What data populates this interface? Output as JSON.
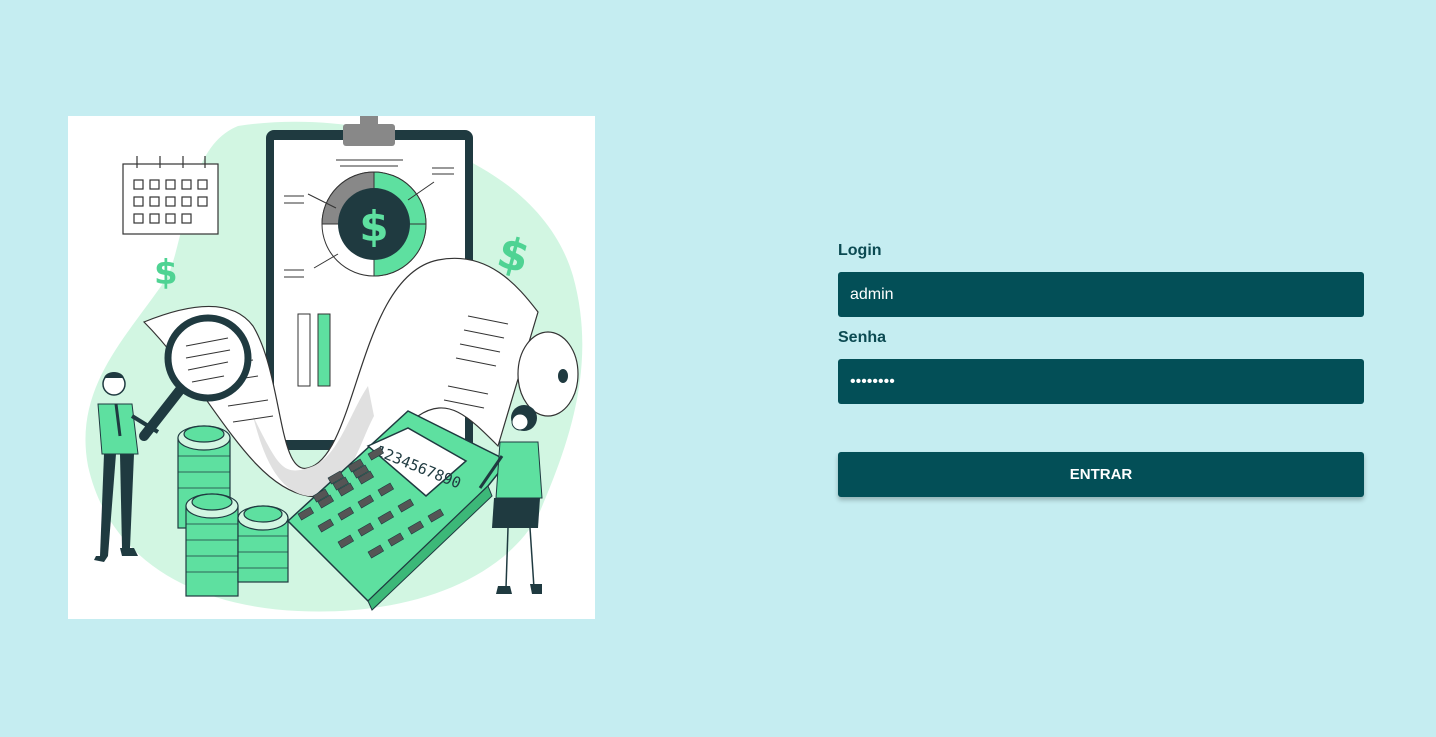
{
  "login_form": {
    "login_label": "Login",
    "login_value": "admin",
    "password_label": "Senha",
    "password_value": "password",
    "submit_label": "ENTRAR"
  },
  "illustration": {
    "calculator_display": "1234567890"
  },
  "colors": {
    "page_background": "#c5edf1",
    "primary": "#034f57",
    "accent_green": "#5ee0a0"
  }
}
